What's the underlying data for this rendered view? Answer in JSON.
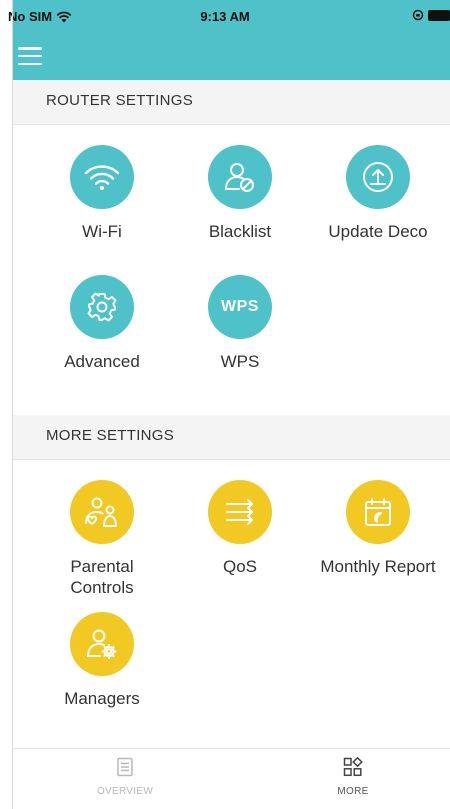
{
  "status_bar": {
    "carrier": "No SIM",
    "time": "9:13 AM"
  },
  "router_settings": {
    "title": "ROUTER SETTINGS",
    "items": [
      {
        "label": "Wi-Fi",
        "icon": "wifi-icon"
      },
      {
        "label": "Blacklist",
        "icon": "blacklist-user-icon"
      },
      {
        "label": "Update Deco",
        "icon": "update-upload-icon"
      },
      {
        "label": "Advanced",
        "icon": "gear-icon"
      },
      {
        "label": "WPS",
        "icon": "wps-icon",
        "icon_text": "WPS"
      }
    ]
  },
  "more_settings": {
    "title": "MORE SETTINGS",
    "items": [
      {
        "label": "Parental\nControls",
        "icon": "parental-controls-icon"
      },
      {
        "label": "QoS",
        "icon": "qos-arrows-icon"
      },
      {
        "label": "Monthly Report",
        "icon": "calendar-report-icon"
      },
      {
        "label": "Managers",
        "icon": "managers-user-gear-icon"
      }
    ]
  },
  "bottom_nav": {
    "overview": "OVERVIEW",
    "more": "MORE",
    "active": "more"
  },
  "colors": {
    "accent_teal": "#4fc1c9",
    "accent_yellow": "#f2c823"
  }
}
